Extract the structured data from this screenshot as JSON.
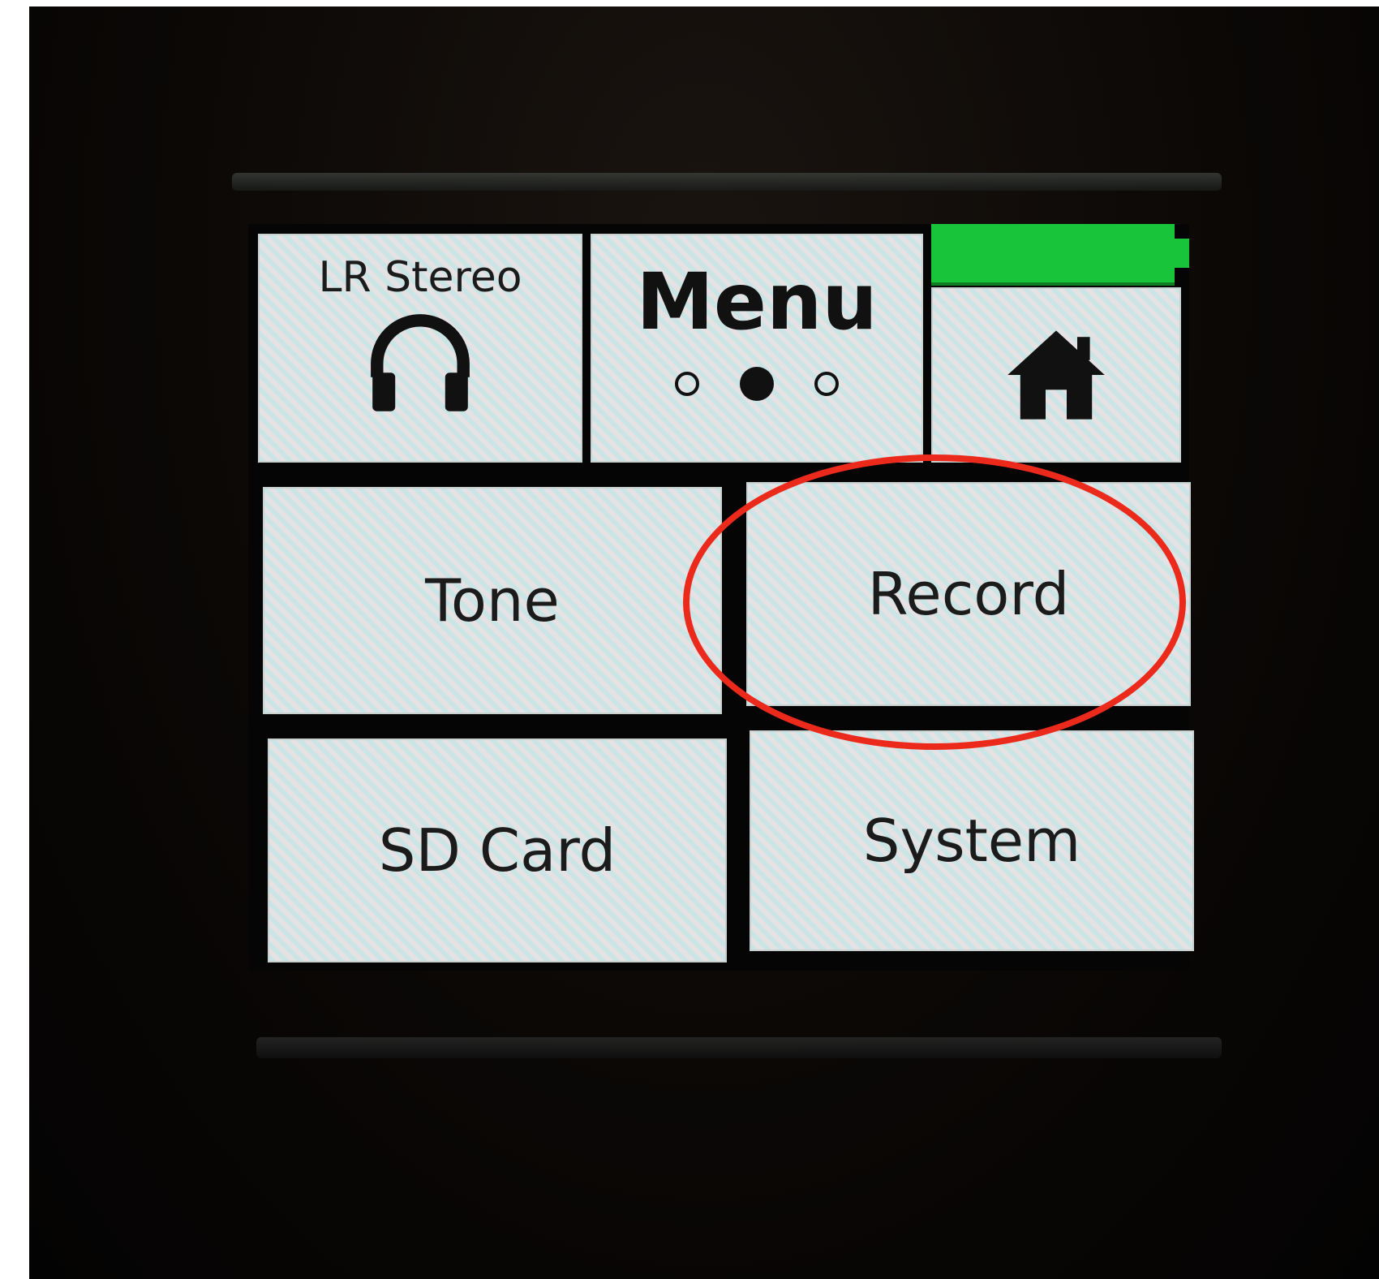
{
  "device_screen": {
    "monitor_tile": {
      "label": "LR Stereo",
      "icon": "headphones-icon"
    },
    "menu_tile": {
      "title": "Menu",
      "pages": [
        "page-1",
        "page-2",
        "page-3"
      ],
      "current_page": 2
    },
    "battery": {
      "level": 1.0,
      "color": "#18c43a"
    },
    "home_tile": {
      "icon": "home-icon"
    },
    "menu_items": [
      {
        "label": "Tone"
      },
      {
        "label": "Record"
      },
      {
        "label": "SD Card"
      },
      {
        "label": "System"
      }
    ]
  },
  "annotation": {
    "highlight_color": "#ec2a1c",
    "highlighted_item": "Record"
  }
}
